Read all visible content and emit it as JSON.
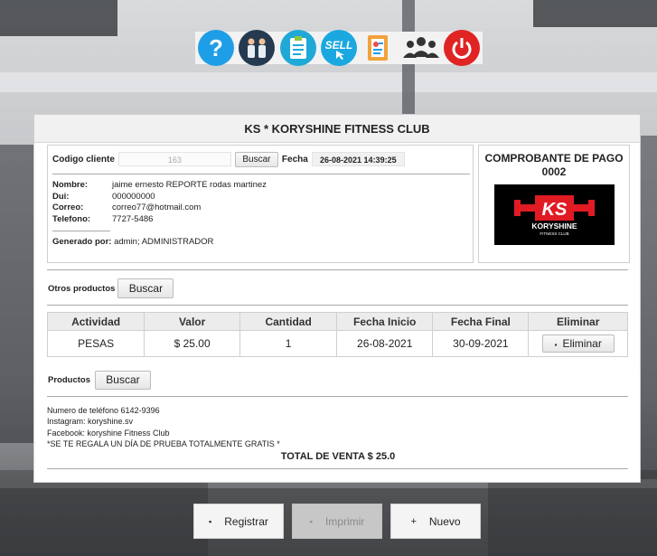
{
  "toolbar": {
    "icons": [
      "help-icon",
      "users-icon",
      "clipboard-icon",
      "sell-icon",
      "report-icon",
      "group-icon",
      "power-icon"
    ],
    "sell_label": "SELL",
    "colors": {
      "help": "#1e9ee6",
      "users": "#263a4f",
      "clipboard": "#1fa9d6",
      "sell": "#1ba8e0",
      "report": "#f2a23a",
      "group": "#333333",
      "power": "#e02424"
    }
  },
  "panel": {
    "title": "KS * KORYSHINE FITNESS CLUB"
  },
  "client": {
    "code_label": "Codigo cliente",
    "code_value": "163",
    "search_label": "Buscar",
    "date_label": "Fecha",
    "date_value": "26-08-2021 14:39:25",
    "fields": [
      {
        "k": "Nombre:",
        "v": "jaime ernesto REPORTE rodas martinez"
      },
      {
        "k": "Dui:",
        "v": "000000000"
      },
      {
        "k": "Correo:",
        "v": "correo77@hotmail.com"
      },
      {
        "k": "Telefono:",
        "v": "7727-5486"
      }
    ],
    "generated_label": "Generado por:",
    "generated_value": "admin; ADMINISTRADOR"
  },
  "receipt": {
    "title": "COMPROBANTE DE PAGO",
    "number": "0002",
    "logo_text": "KORYSHINE",
    "logo_sub": "FITNESS CLUB"
  },
  "other_products": {
    "label": "Otros productos",
    "button": "Buscar"
  },
  "products": {
    "label": "Productos",
    "button": "Buscar"
  },
  "table": {
    "headers": [
      "Actividad",
      "Valor",
      "Cantidad",
      "Fecha Inicio",
      "Fecha Final",
      "Eliminar"
    ],
    "rows": [
      {
        "actividad": "PESAS",
        "valor": "$ 25.00",
        "cantidad": "1",
        "inicio": "26-08-2021",
        "final": "30-09-2021",
        "eliminar": "Eliminar"
      }
    ]
  },
  "footer": {
    "lines": [
      "Numero de teléfono 6142-9396",
      "Instagram: koryshine.sv",
      "Facebook: koryshine Fitness Club",
      "*SE TE REGALA UN DÍA DE PRUEBA TOTALMENTE GRATIS *"
    ],
    "total": "TOTAL DE VENTA $ 25.0"
  },
  "actions": {
    "register": "Registrar",
    "print": "Imprimir",
    "new": "Nuevo",
    "new_icon": "+"
  }
}
